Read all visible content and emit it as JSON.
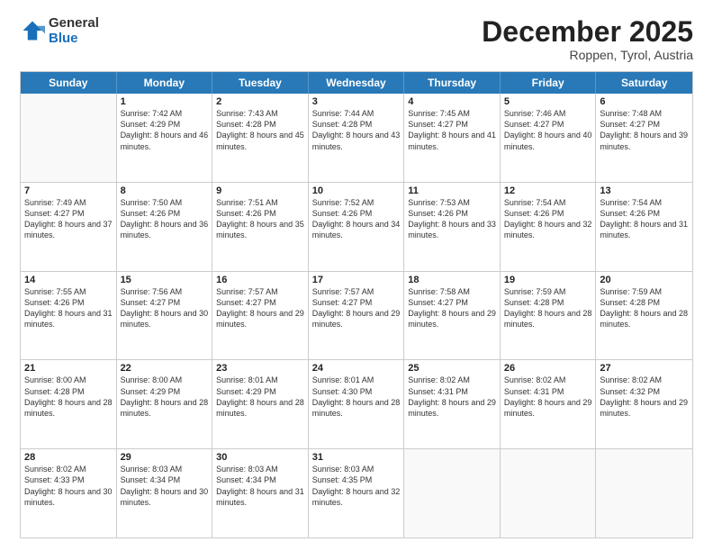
{
  "logo": {
    "general": "General",
    "blue": "Blue"
  },
  "title": "December 2025",
  "location": "Roppen, Tyrol, Austria",
  "days": [
    "Sunday",
    "Monday",
    "Tuesday",
    "Wednesday",
    "Thursday",
    "Friday",
    "Saturday"
  ],
  "weeks": [
    [
      {
        "day": "",
        "empty": true
      },
      {
        "day": "1",
        "sunrise": "7:42 AM",
        "sunset": "4:29 PM",
        "daylight": "8 hours and 46 minutes."
      },
      {
        "day": "2",
        "sunrise": "7:43 AM",
        "sunset": "4:28 PM",
        "daylight": "8 hours and 45 minutes."
      },
      {
        "day": "3",
        "sunrise": "7:44 AM",
        "sunset": "4:28 PM",
        "daylight": "8 hours and 43 minutes."
      },
      {
        "day": "4",
        "sunrise": "7:45 AM",
        "sunset": "4:27 PM",
        "daylight": "8 hours and 41 minutes."
      },
      {
        "day": "5",
        "sunrise": "7:46 AM",
        "sunset": "4:27 PM",
        "daylight": "8 hours and 40 minutes."
      },
      {
        "day": "6",
        "sunrise": "7:48 AM",
        "sunset": "4:27 PM",
        "daylight": "8 hours and 39 minutes."
      }
    ],
    [
      {
        "day": "7",
        "sunrise": "7:49 AM",
        "sunset": "4:27 PM",
        "daylight": "8 hours and 37 minutes."
      },
      {
        "day": "8",
        "sunrise": "7:50 AM",
        "sunset": "4:26 PM",
        "daylight": "8 hours and 36 minutes."
      },
      {
        "day": "9",
        "sunrise": "7:51 AM",
        "sunset": "4:26 PM",
        "daylight": "8 hours and 35 minutes."
      },
      {
        "day": "10",
        "sunrise": "7:52 AM",
        "sunset": "4:26 PM",
        "daylight": "8 hours and 34 minutes."
      },
      {
        "day": "11",
        "sunrise": "7:53 AM",
        "sunset": "4:26 PM",
        "daylight": "8 hours and 33 minutes."
      },
      {
        "day": "12",
        "sunrise": "7:54 AM",
        "sunset": "4:26 PM",
        "daylight": "8 hours and 32 minutes."
      },
      {
        "day": "13",
        "sunrise": "7:54 AM",
        "sunset": "4:26 PM",
        "daylight": "8 hours and 31 minutes."
      }
    ],
    [
      {
        "day": "14",
        "sunrise": "7:55 AM",
        "sunset": "4:26 PM",
        "daylight": "8 hours and 31 minutes."
      },
      {
        "day": "15",
        "sunrise": "7:56 AM",
        "sunset": "4:27 PM",
        "daylight": "8 hours and 30 minutes."
      },
      {
        "day": "16",
        "sunrise": "7:57 AM",
        "sunset": "4:27 PM",
        "daylight": "8 hours and 29 minutes."
      },
      {
        "day": "17",
        "sunrise": "7:57 AM",
        "sunset": "4:27 PM",
        "daylight": "8 hours and 29 minutes."
      },
      {
        "day": "18",
        "sunrise": "7:58 AM",
        "sunset": "4:27 PM",
        "daylight": "8 hours and 29 minutes."
      },
      {
        "day": "19",
        "sunrise": "7:59 AM",
        "sunset": "4:28 PM",
        "daylight": "8 hours and 28 minutes."
      },
      {
        "day": "20",
        "sunrise": "7:59 AM",
        "sunset": "4:28 PM",
        "daylight": "8 hours and 28 minutes."
      }
    ],
    [
      {
        "day": "21",
        "sunrise": "8:00 AM",
        "sunset": "4:28 PM",
        "daylight": "8 hours and 28 minutes."
      },
      {
        "day": "22",
        "sunrise": "8:00 AM",
        "sunset": "4:29 PM",
        "daylight": "8 hours and 28 minutes."
      },
      {
        "day": "23",
        "sunrise": "8:01 AM",
        "sunset": "4:29 PM",
        "daylight": "8 hours and 28 minutes."
      },
      {
        "day": "24",
        "sunrise": "8:01 AM",
        "sunset": "4:30 PM",
        "daylight": "8 hours and 28 minutes."
      },
      {
        "day": "25",
        "sunrise": "8:02 AM",
        "sunset": "4:31 PM",
        "daylight": "8 hours and 29 minutes."
      },
      {
        "day": "26",
        "sunrise": "8:02 AM",
        "sunset": "4:31 PM",
        "daylight": "8 hours and 29 minutes."
      },
      {
        "day": "27",
        "sunrise": "8:02 AM",
        "sunset": "4:32 PM",
        "daylight": "8 hours and 29 minutes."
      }
    ],
    [
      {
        "day": "28",
        "sunrise": "8:02 AM",
        "sunset": "4:33 PM",
        "daylight": "8 hours and 30 minutes."
      },
      {
        "day": "29",
        "sunrise": "8:03 AM",
        "sunset": "4:34 PM",
        "daylight": "8 hours and 30 minutes."
      },
      {
        "day": "30",
        "sunrise": "8:03 AM",
        "sunset": "4:34 PM",
        "daylight": "8 hours and 31 minutes."
      },
      {
        "day": "31",
        "sunrise": "8:03 AM",
        "sunset": "4:35 PM",
        "daylight": "8 hours and 32 minutes."
      },
      {
        "day": "",
        "empty": true
      },
      {
        "day": "",
        "empty": true
      },
      {
        "day": "",
        "empty": true
      }
    ]
  ]
}
